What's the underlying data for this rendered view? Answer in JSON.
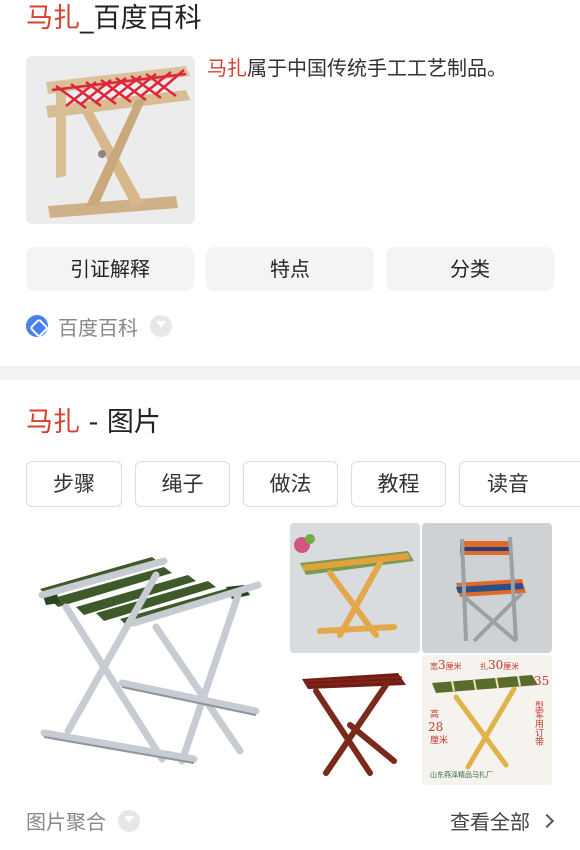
{
  "baike": {
    "title_keyword": "马扎",
    "title_suffix": "_百度百科",
    "desc_keyword": "马扎",
    "desc_rest": "属于中国传统手工工艺制品。",
    "buttons": [
      "引证解释",
      "特点",
      "分类"
    ],
    "source_label": "百度百科"
  },
  "images": {
    "title_keyword": "马扎",
    "title_suffix": " - 图片",
    "tags": [
      "步骤",
      "绳子",
      "做法",
      "教程",
      "读音"
    ],
    "thumb_texts": {
      "width": "宽",
      "width_num": "3",
      "length_unit": "厘米",
      "stretch": "扎",
      "stretch_num": "30",
      "stretch_unit": "厘米",
      "height": "高",
      "height_num": "28",
      "height_unit": "厘米",
      "num35": "35",
      "model": "型军用订带",
      "shop": "山东燕泽精品马扎厂"
    },
    "aggregate_label": "图片聚合",
    "view_all_label": "查看全部"
  },
  "colors": {
    "highlight": "#d8402f",
    "divider": "#f1f2f4",
    "button_bg": "#f3f4f6"
  }
}
